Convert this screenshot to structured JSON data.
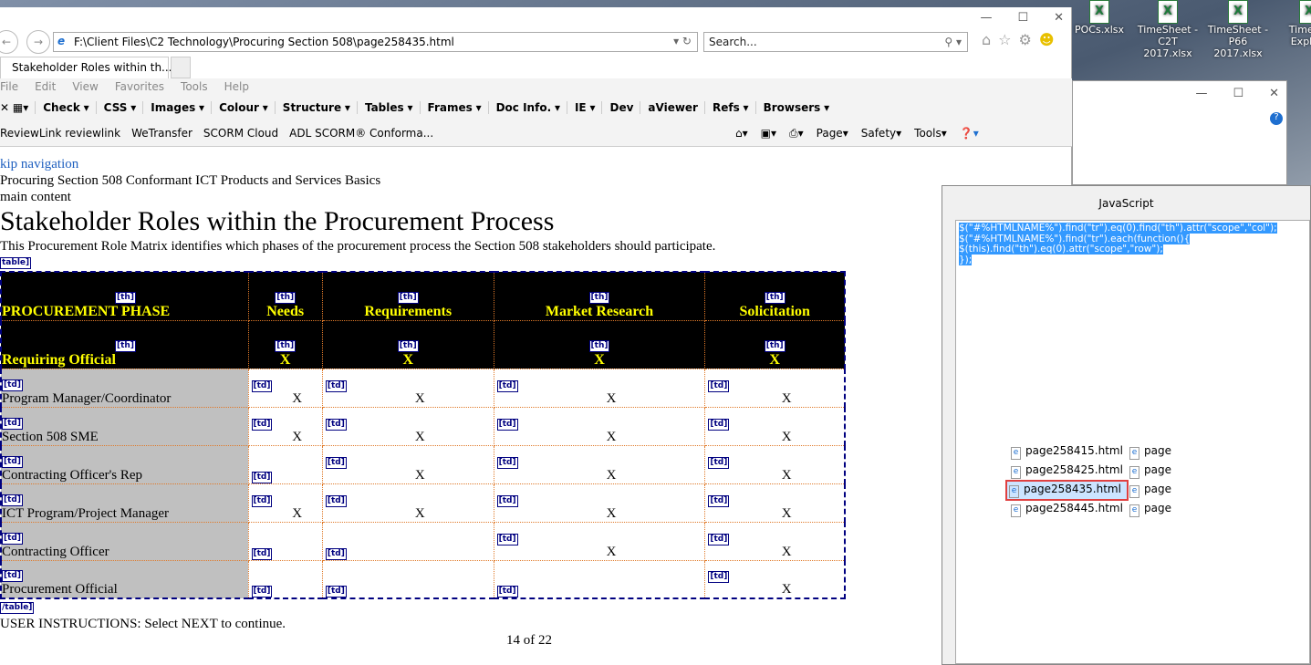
{
  "desktop": {
    "icons": [
      {
        "label": "POCs.xlsx"
      },
      {
        "label": "TimeSheet - C2T 2017.xlsx"
      },
      {
        "label": "TimeSheet - P66 2017.xlsx"
      },
      {
        "label": "TimeS... Explo..."
      }
    ]
  },
  "browser": {
    "address": "F:\\Client Files\\C2 Technology\\Procuring Section 508\\page258435.html",
    "search_placeholder": "Search...",
    "tab_title": "Stakeholder Roles within th...",
    "menu": [
      "File",
      "Edit",
      "View",
      "Favorites",
      "Tools",
      "Help"
    ],
    "toolbar": [
      "Check",
      "CSS",
      "Images",
      "Colour",
      "Structure",
      "Tables",
      "Frames",
      "Doc Info.",
      "IE",
      "Dev",
      "aViewer",
      "Refs",
      "Browsers"
    ],
    "favorites": [
      "ReviewLink  reviewlink",
      "WeTransfer",
      "SCORM Cloud",
      "ADL SCORM® Conforma..."
    ],
    "commands": [
      "Page",
      "Safety",
      "Tools"
    ]
  },
  "page": {
    "skip": "kip navigation",
    "course": "Procuring Section 508 Conformant ICT Products and Services Basics",
    "main": "main content",
    "title": "Stakeholder Roles within the Procurement Process",
    "intro": "This Procurement Role Matrix identifies which phases of the procurement process the Section 508 stakeholders should participate.",
    "table_tag": "table]",
    "end_table_tag": "/table]",
    "th_tag": "[th]",
    "td_tag": "[td]",
    "headers": [
      "PROCUREMENT PHASE",
      "Needs",
      "Requirements",
      "Market Research",
      "Solicitation"
    ],
    "header_row2": {
      "role": "Requiring Official",
      "marks": [
        "X",
        "X",
        "X",
        "X"
      ]
    },
    "rows": [
      {
        "role": "Program Manager/Coordinator",
        "marks": [
          "X",
          "X",
          "X",
          "X"
        ]
      },
      {
        "role": "Section 508 SME",
        "marks": [
          "X",
          "X",
          "X",
          "X"
        ]
      },
      {
        "role": "Contracting Officer's Rep",
        "marks": [
          "",
          "X",
          "X",
          "X"
        ]
      },
      {
        "role": "ICT Program/Project Manager",
        "marks": [
          "X",
          "X",
          "X",
          "X"
        ]
      },
      {
        "role": "Contracting Officer",
        "marks": [
          "",
          "",
          "X",
          "X"
        ]
      },
      {
        "role": "Procurement Official",
        "marks": [
          "",
          "",
          "",
          "X"
        ]
      }
    ],
    "instructions": "USER INSTRUCTIONS:  Select NEXT to continue.",
    "pager": "14 of 22"
  },
  "js_dialog": {
    "title": "JavaScript",
    "code": [
      "$(\"#%HTMLNAME%\").find(\"tr\").eq(0).find(\"th\").attr(\"scope\",\"col\");",
      "$(\"#%HTMLNAME%\").find(\"tr\").each(function(){",
      "$(this).find(\"th\").eq(0).attr(\"scope\",\"row\");",
      "});"
    ]
  },
  "files": {
    "col1": [
      "page258415.html",
      "page258425.html",
      "page258435.html",
      "page258445.html"
    ],
    "col2": [
      "page",
      "page",
      "page",
      "page"
    ],
    "selected": "page258435.html"
  }
}
